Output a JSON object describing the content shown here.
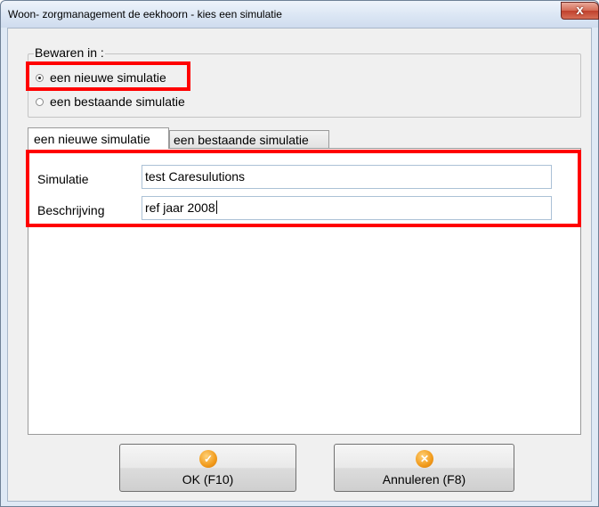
{
  "window": {
    "title": "Woon- zorgmanagement de eekhoorn - kies een simulatie",
    "close_glyph": "x"
  },
  "save_in": {
    "label": "Bewaren in :",
    "options": [
      {
        "label": "een nieuwe simulatie",
        "selected": true
      },
      {
        "label": "een bestaande simulatie",
        "selected": false
      }
    ]
  },
  "tabs": [
    {
      "label": "een nieuwe simulatie",
      "active": true
    },
    {
      "label": "een bestaande simulatie",
      "active": false
    }
  ],
  "form": {
    "simulatie_label": "Simulatie",
    "simulatie_value": "test Caresulutions",
    "beschrijving_label": "Beschrijving",
    "beschrijving_value": "ref jaar 2008"
  },
  "buttons": {
    "ok_label": "OK (F10)",
    "ok_icon": "check-circle-icon",
    "ok_glyph": "✓",
    "cancel_label": "Annuleren (F8)",
    "cancel_icon": "cancel-circle-icon",
    "cancel_glyph": "✕"
  },
  "colors": {
    "highlight": "#ff0000",
    "button_icon": "#f19a1a"
  }
}
